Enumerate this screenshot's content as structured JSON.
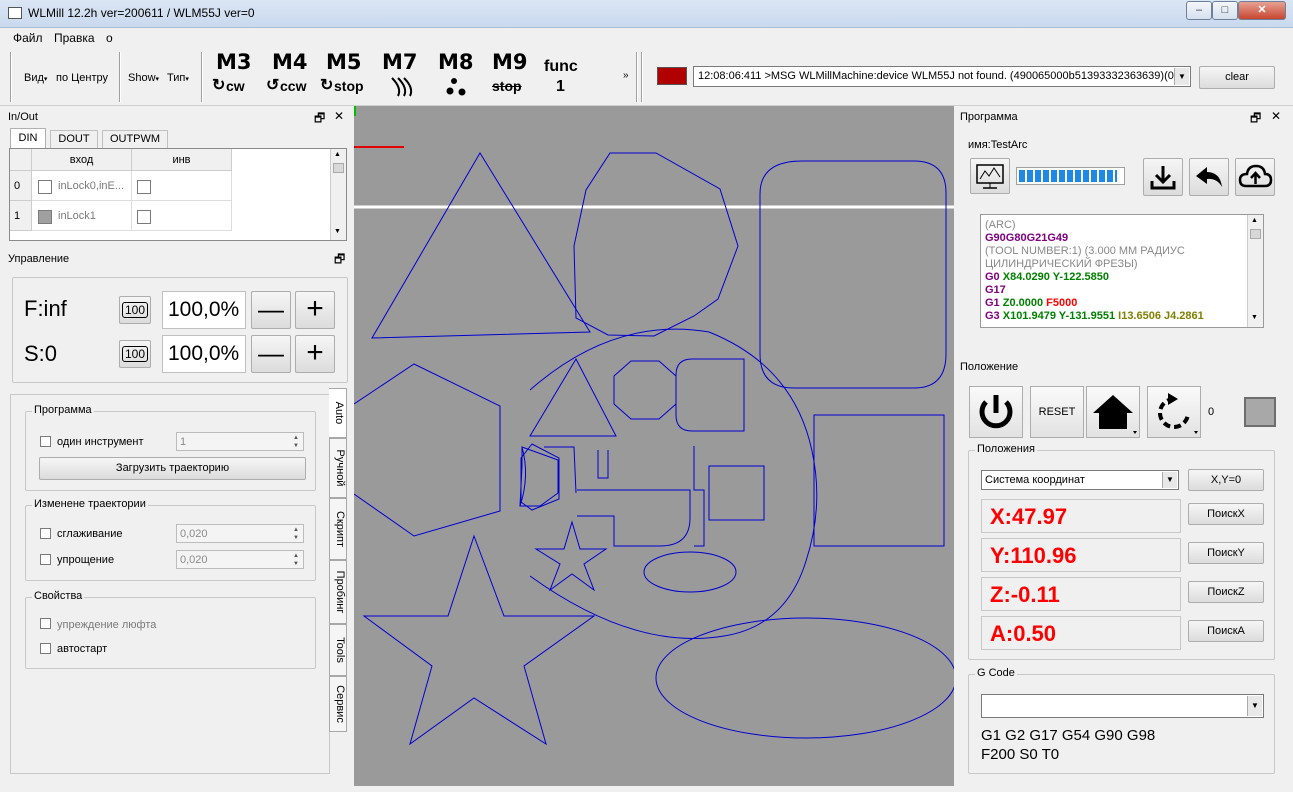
{
  "window": {
    "title": "WLMill 12.2h ver=200611 / WLM55J ver=0",
    "minimize": "–",
    "maximize": "□",
    "close": "✕"
  },
  "menu": {
    "file": "Файл",
    "edit": "Правка",
    "other": "o"
  },
  "toolbar": {
    "view": "Вид",
    "center": "по Центру",
    "show": "Show",
    "type": "Тип",
    "m3": "M3",
    "m3_sub": "cw",
    "m4": "M4",
    "m4_sub": "ccw",
    "m5": "M5",
    "m5_sub": "stop",
    "m7": "M7",
    "m8": "M8",
    "m9": "M9",
    "m9_sub": "stop",
    "func": "func",
    "func_num": "1",
    "more": "»",
    "log": "12:08:06:411 >MSG WLMillMachine:device WLM55J not found. (490065000b51393332363639)(0)...",
    "clear": "clear",
    "status_color": "#b00000"
  },
  "inout": {
    "title": "In/Out",
    "tabs": [
      "DIN",
      "DOUT",
      "OUTPWM"
    ],
    "col_input": "вход",
    "col_inv": "инв",
    "rows": [
      {
        "num": "0",
        "name": "inLock0,inE..."
      },
      {
        "num": "1",
        "name": "inLock1"
      }
    ]
  },
  "control": {
    "title": "Управление",
    "f_label": "F:inf",
    "s_label": "S:0",
    "preset": "100",
    "f_value": "100,0%",
    "s_value": "100,0%",
    "minus": "—",
    "plus": "+"
  },
  "auto": {
    "program_group": "Программа",
    "one_tool": "один инструмент",
    "one_tool_value": "1",
    "load_traj": "Загрузить траекторию",
    "change_group": "Изменене траектории",
    "smoothing": "сглаживание",
    "smoothing_value": "0,020",
    "simplify": "упрощение",
    "simplify_value": "0,020",
    "props_group": "Свойства",
    "backlash": "упреждение люфта",
    "autostart": "автостарт"
  },
  "vtabs": [
    "Auto",
    "Ручной",
    "Скрипт",
    "Пробинг",
    "Tools",
    "Сервис"
  ],
  "program": {
    "title": "Программа",
    "name": "имя:TestArc",
    "gcode_lines": [
      [
        {
          "t": "(ARC)",
          "c": "#888888"
        }
      ],
      [
        {
          "t": "G90G80G21G49",
          "c": "#800080",
          "b": true
        }
      ],
      [
        {
          "t": "(TOOL NUMBER",
          "c": "#888888"
        },
        {
          "t": ":1) ",
          "c": "#888888"
        },
        {
          "t": "(3.000 MM РАДИУС",
          "c": "#888888"
        }
      ],
      [
        {
          "t": "ЦИЛИНДРИЧЕСКИЙ ФРЕЗЫ)",
          "c": "#888888"
        }
      ],
      [
        {
          "t": "G0 ",
          "c": "#800080",
          "b": true
        },
        {
          "t": "X84.0290 Y-122.5850",
          "c": "#008000",
          "b": true
        }
      ],
      [
        {
          "t": "G17",
          "c": "#800080",
          "b": true
        }
      ],
      [
        {
          "t": "G1 ",
          "c": "#800080",
          "b": true
        },
        {
          "t": "Z0.0000 ",
          "c": "#008000",
          "b": true
        },
        {
          "t": "F5000",
          "c": "#ff0000",
          "b": true
        }
      ],
      [
        {
          "t": "G3 ",
          "c": "#800080",
          "b": true
        },
        {
          "t": "X101.9479 Y-131.9551 ",
          "c": "#008000",
          "b": true
        },
        {
          "t": "I13.6506 J4.2861",
          "c": "#808000",
          "b": true
        }
      ]
    ],
    "progress": 0.95
  },
  "position": {
    "title": "Положение",
    "reset": "RESET",
    "counter": "0",
    "group": "Положения",
    "coord_system": "Система координат",
    "xy0": "X,Y=0",
    "x": "X:47.97",
    "y": "Y:110.96",
    "z": "Z:-0.11",
    "a": "A:0.50",
    "find_x": "ПоискX",
    "find_y": "ПоискY",
    "find_z": "ПоискZ",
    "find_a": "ПоискA"
  },
  "gcode": {
    "group": "G Code",
    "modal1": "G1 G2 G17 G54 G90 G98",
    "modal2": "F200 S0 T0"
  }
}
